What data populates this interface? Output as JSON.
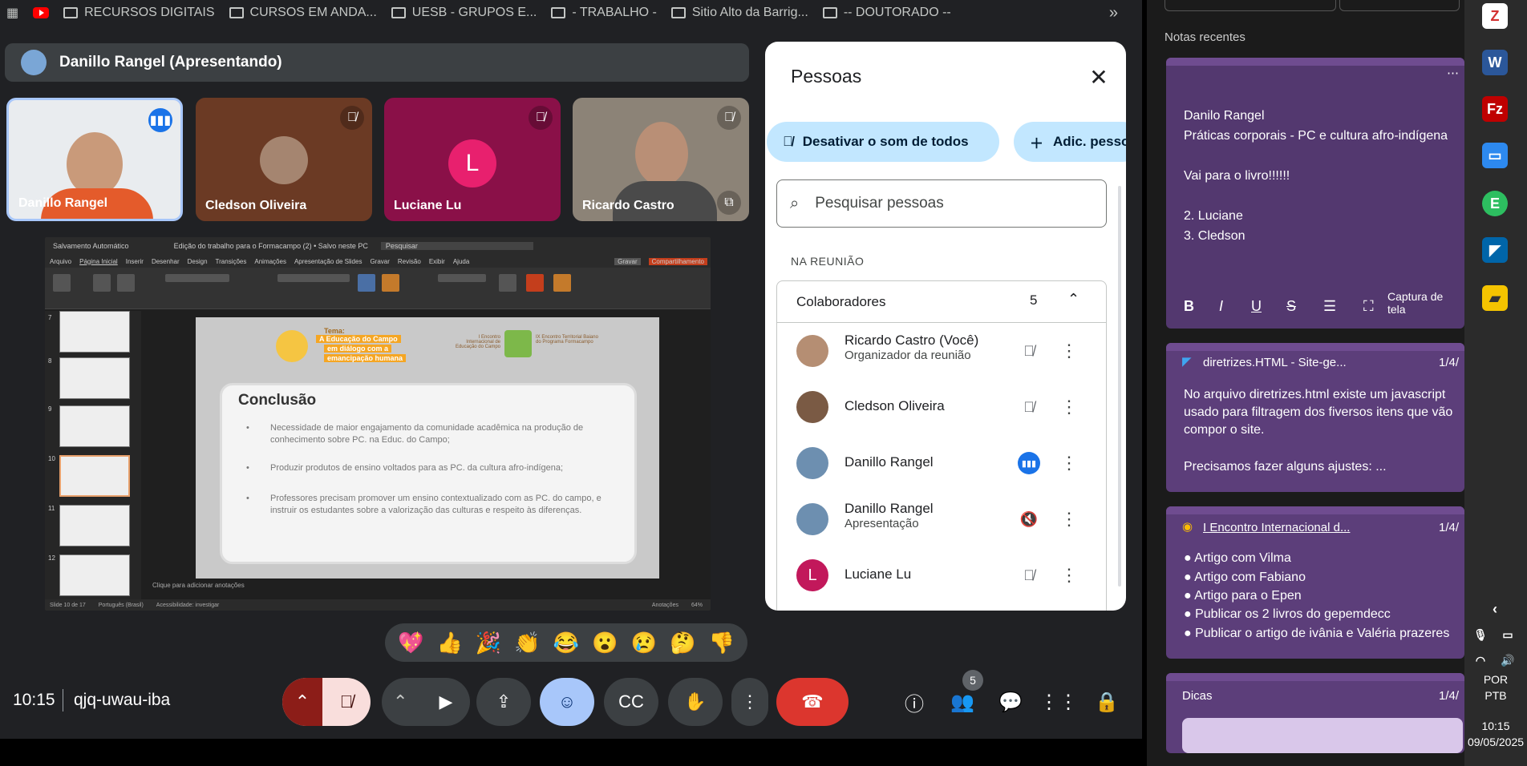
{
  "bookmarks": [
    "RECURSOS DIGITAIS",
    "CURSOS EM ANDA...",
    "UESB - GRUPOS E...",
    "- TRABALHO -",
    "Sitio Alto da Barrig...",
    "-- DOUTORADO --"
  ],
  "bookmarks_more": "»",
  "presenter": "Danillo Rangel (Apresentando)",
  "tiles": [
    {
      "name": "Danillo Rangel"
    },
    {
      "name": "Cledson Oliveira"
    },
    {
      "name": "Luciane Lu",
      "initial": "L"
    },
    {
      "name": "Ricardo Castro"
    }
  ],
  "ppt": {
    "title_left": "Salvamento Automático",
    "doc_title": "Edição do trabalho para o Formacampo (2) • Salvo neste PC",
    "search": "Pesquisar",
    "menu": [
      "Arquivo",
      "Página Inicial",
      "Inserir",
      "Desenhar",
      "Design",
      "Transições",
      "Animações",
      "Apresentação de Slides",
      "Gravar",
      "Revisão",
      "Exibir",
      "Ajuda"
    ],
    "record": "Gravar",
    "share": "Compartilhamento",
    "thumb_numbers": [
      "7",
      "8",
      "9",
      "10",
      "11",
      "12"
    ],
    "slide_tema": "Tema:",
    "slide_badge_1": "A Educação do Campo",
    "slide_badge_2": "em diálogo com a",
    "slide_badge_3": "emancipação humana",
    "slide_event_1": "I Encontro Internacional de Educação do Campo",
    "slide_event_2": "IX Encontro Territorial Baiano do Programa Formacampo",
    "slide_heading": "Conclusão",
    "bullets": [
      "Necessidade de maior engajamento da comunidade acadêmica na produção de conhecimento sobre PC. na Educ. do Campo;",
      "Produzir produtos de ensino voltados para as PC. da cultura afro-indígena;",
      "Professores precisam promover um ensino contextualizado com as PC. do campo, e instruir os estudantes sobre a valorização das culturas e respeito às diferenças."
    ],
    "notes_placeholder": "Clique para adicionar anotações",
    "status": [
      "Slide 10 de 17",
      "Português (Brasil)",
      "Acessibilidade: investigar",
      "Anotações",
      "64%"
    ]
  },
  "reactions": [
    "💖",
    "👍",
    "🎉",
    "👏",
    "😂",
    "😮",
    "😢",
    "🤔",
    "👎"
  ],
  "bottom": {
    "time": "10:15",
    "code": "qjq-uwau-iba",
    "people_count": "5"
  },
  "people_panel": {
    "title": "Pessoas",
    "mute_all": "Desativar o som de todos",
    "add": "Adic. pessoas",
    "search_placeholder": "Pesquisar pessoas",
    "section": "NA REUNIÃO",
    "group": "Colaboradores",
    "group_count": "5",
    "people": [
      {
        "name": "Ricardo Castro (Você)",
        "sub": "Organizador da reunião",
        "status": "muted"
      },
      {
        "name": "Cledson Oliveira",
        "sub": "",
        "status": "muted"
      },
      {
        "name": "Danillo Rangel",
        "sub": "",
        "status": "speaking"
      },
      {
        "name": "Danillo Rangel",
        "sub": "Apresentação",
        "status": "audio-off"
      },
      {
        "name": "Luciane Lu",
        "sub": "",
        "status": "muted",
        "initial": "L"
      }
    ]
  },
  "notes": {
    "title": "Notas recentes",
    "note1": [
      "Danilo Rangel",
      "Práticas corporais - PC e cultura afro-indígena",
      "",
      "Vai para o livro!!!!!!",
      "",
      "2. Luciane",
      "3. Cledson"
    ],
    "note1_toolbar_capture": "Captura de tela",
    "note2_source": "diretrizes.HTML - Site-ge...",
    "note2_date": "1/4/",
    "note2": [
      "No arquivo diretrizes.html existe um javascript",
      "usado para filtragem dos fiversos itens que vão",
      "compor o site.",
      "",
      "Precisamos fazer alguns ajustes: ..."
    ],
    "note3_source": "I Encontro Internacional d...",
    "note3_date": "1/4/",
    "note3": [
      "● Artigo com Vilma",
      "● Artigo com Fabiano",
      "● Artigo para o Epen",
      "● Publicar os 2 livros do gepemdecc",
      "● Publicar o artigo de ivânia e Valéria prazeres"
    ],
    "note4_title": "Dicas",
    "note4_date": "1/4/"
  },
  "taskbar": {
    "lang1": "POR",
    "lang2": "PTB",
    "time": "10:15",
    "date": "09/05/2025"
  }
}
